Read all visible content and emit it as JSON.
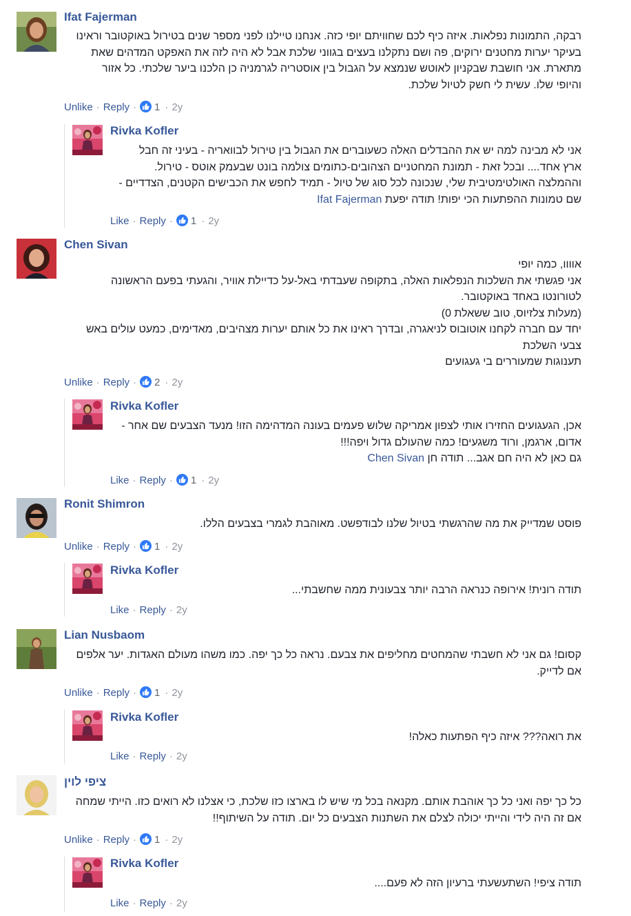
{
  "colors": {
    "link": "#385898",
    "meta": "#90949c",
    "like_badge": "#2f79f6"
  },
  "icons": {
    "reaction": "like-thumb-icon"
  },
  "comments": [
    {
      "author": "Ifat Fajerman",
      "lines": [
        "רבקה, התמונות נפלאות. איזה כיף לכם שחוויתם יופי כזה. אנחנו טיילנו לפני מספר שנים בטירול באוקטובר וראינו",
        "בעיקר יערות מחטנים ירוקים, פה ושם נתקלנו בעצים בגווני שלכת אבל לא היה לזה את האפקט המדהים שאת",
        "מתארת. אני חושבת שבקניון לאוטש שנמצא על הגבול בין אוסטריה לגרמניה כן הלכנו ביער שלכתי. כל אזור",
        "והיופי שלו. עשית לי חשק לטיול שלכת."
      ],
      "actions": {
        "like": "Unlike",
        "reply": "Reply",
        "count": "1",
        "time": "2y"
      },
      "reply": {
        "author": "Rivka Kofler",
        "lines": [
          "אני לא מבינה למה יש את ההבדלים האלה כשעוברים את הגבול בין טירול לבוואריה - בעיני זה חבל",
          "ארץ אחד.... ובכל זאת - תמונת המחטניים הצהובים-כתומים צולמה בונט שבעמק אוטס - טירול.",
          "וההמלצה האולטימטיבית שלי, שנכונה לכל סוג של טיול - תמיד לחפש את הכבישים הקטנים, הצדדיים -"
        ],
        "last_line": {
          "mention": "Ifat Fajerman",
          "text": "שם טמונות ההפתעות הכי יפות! תודה יפעת"
        },
        "actions": {
          "like": "Like",
          "reply": "Reply",
          "count": "1",
          "time": "2y"
        }
      }
    },
    {
      "author": "Chen Sivan",
      "lines": [
        "אוווו, כמה יופי",
        "אני פגשתי את השלכות הנפלאות האלה, בתקופה שעבדתי באל-על כדיילת אוויר, והגעתי בפעם הראשונה",
        "לטורונטו באחד באוקטובר.",
        "(מעלות צלזיוס, טוב ששאלת 0)",
        "יחד עם חברה לקחנו אוטובוס לניאגרה, ובדרך ראינו את כל אותם יערות מצהיבים, מאדימים, כמעט עולים באש",
        "צבעי השלכת",
        "תענוגות שמעוררים בי געגועים"
      ],
      "actions": {
        "like": "Unlike",
        "reply": "Reply",
        "count": "2",
        "time": "2y"
      },
      "reply": {
        "author": "Rivka Kofler",
        "lines": [
          "אכן, הגעגועים החזירו אותי לצפון אמריקה שלוש פעמים בעונה המדהימה הזו! מנעד הצבעים שם אחר -",
          "אדום, ארגמן, ורוד משגעים! כמה שהעולם גדול ויפה!!!"
        ],
        "last_line": {
          "mention": "Chen Sivan",
          "text": "גם כאן לא היה חם אגב... תודה חן"
        },
        "actions": {
          "like": "Like",
          "reply": "Reply",
          "count": "1",
          "time": "2y"
        }
      }
    },
    {
      "author": "Ronit Shimron",
      "lines": [
        "פוסט שמדייק את מה שהרגשתי בטיול שלנו לבודפשט. מאוהבת לגמרי בצבעים הללו."
      ],
      "actions": {
        "like": "Unlike",
        "reply": "Reply",
        "count": "1",
        "time": "2y"
      },
      "reply": {
        "author": "Rivka Kofler",
        "lines": [
          "תודה רונית! אירופה כנראה הרבה יותר צבעונית ממה שחשבתי..."
        ],
        "actions": {
          "like": "Like",
          "reply": "Reply",
          "time": "2y"
        }
      }
    },
    {
      "author": "Lian Nusbaom",
      "lines": [
        "קסום! גם אני לא חשבתי שהמחטים מחליפים את צבעם. נראה כל כך יפה. כמו משהו מעולם האגדות. יער אלפים",
        "אם לדייק."
      ],
      "actions": {
        "like": "Unlike",
        "reply": "Reply",
        "count": "1",
        "time": "2y"
      },
      "reply": {
        "author": "Rivka Kofler",
        "lines": [
          "את רואה??? איזה כיף הפתעות כאלה!"
        ],
        "actions": {
          "like": "Like",
          "reply": "Reply",
          "time": "2y"
        }
      }
    },
    {
      "author": "ציפי לוין",
      "lines": [
        "כל כך יפה ואני כל כך אוהבת אותם. מקנאה בכל מי שיש לו בארצו כזו שלכת, כי אצלנו לא רואים כזו. הייתי שמחה",
        "אם זה היה לידי והייתי יכולה לצלם את השתנות הצבעים כל יום. תודה על השיתוף!!"
      ],
      "actions": {
        "like": "Unlike",
        "reply": "Reply",
        "count": "1",
        "time": "2y"
      },
      "reply": {
        "author": "Rivka Kofler",
        "lines": [
          "תודה ציפי! השתעשעתי ברעיון הזה לא פעם...."
        ],
        "actions": {
          "like": "Like",
          "reply": "Reply",
          "time": "2y"
        }
      }
    }
  ]
}
